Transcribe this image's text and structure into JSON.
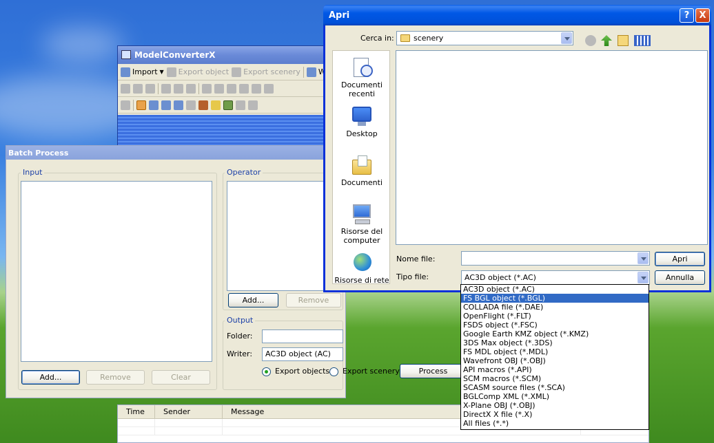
{
  "mcx": {
    "title": "ModelConverterX",
    "toolbar": {
      "import_label": "Import",
      "export_object_label": "Export object",
      "export_scenery_label": "Export scenery",
      "w_label": "W"
    }
  },
  "batch": {
    "title": "Batch Process",
    "input_label": "Input",
    "operator_label": "Operator",
    "output_label": "Output",
    "input_add": "Add...",
    "input_remove": "Remove",
    "input_clear": "Clear",
    "operator_add": "Add...",
    "operator_remove": "Remove",
    "folder_label": "Folder:",
    "folder_value": "",
    "writer_label": "Writer:",
    "writer_value": "AC3D object (AC)",
    "export_objects_label": "Export objects",
    "export_scenery_label": "Export scenery",
    "export_mode_selected": "Export objects",
    "process_label": "Process"
  },
  "log": {
    "columns": [
      "Time",
      "Sender",
      "Message"
    ]
  },
  "apri": {
    "title": "Apri",
    "help_glyph": "?",
    "close_glyph": "X",
    "cerca_label": "Cerca in:",
    "cerca_value": "scenery",
    "places": [
      {
        "label": "Documenti recenti",
        "icon": "recent-documents-icon"
      },
      {
        "label": "Desktop",
        "icon": "desktop-icon"
      },
      {
        "label": "Documenti",
        "icon": "documents-folder-icon"
      },
      {
        "label": "Risorse del computer",
        "icon": "my-computer-icon"
      },
      {
        "label": "Risorse di rete",
        "icon": "network-icon"
      }
    ],
    "nome_label": "Nome file:",
    "nome_value": "",
    "tipo_label": "Tipo file:",
    "tipo_value": "AC3D object (*.AC)",
    "open_label": "Apri",
    "cancel_label": "Annulla"
  },
  "filetype_options": [
    "AC3D object (*.AC)",
    "FS BGL object (*.BGL)",
    "COLLADA file (*.DAE)",
    "OpenFlight (*.FLT)",
    "FSDS object (*.FSC)",
    "Google Earth KMZ object (*.KMZ)",
    "3DS Max object (*.3DS)",
    "FS MDL object (*.MDL)",
    "Wavefront OBJ (*.OBJ)",
    "API macros (*.API)",
    "SCM macros (*.SCM)",
    "SCASM source files (*.SCA)",
    "BGLComp XML (*.XML)",
    "X-Plane OBJ (*.OBJ)",
    "DirectX X file (*.X)",
    "All files (*.*)"
  ],
  "filetype_highlighted": "FS BGL object (*.BGL)",
  "colors": {
    "xp_title_blue": "#0058e6",
    "selection": "#316ac5",
    "window_face": "#ece9d8"
  }
}
